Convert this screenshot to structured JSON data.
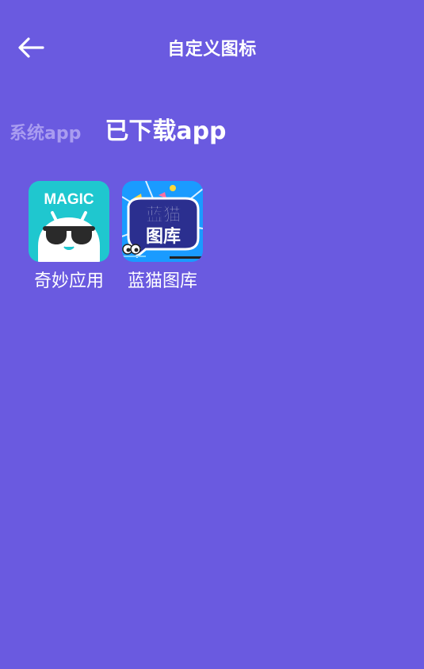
{
  "header": {
    "title": "自定义图标",
    "back_icon": "arrow-left-icon"
  },
  "tabs": [
    {
      "label": "系统app",
      "active": false
    },
    {
      "label": "已下载app",
      "active": true
    }
  ],
  "apps": [
    {
      "name": "奇妙应用",
      "icon": "magic-app-icon",
      "icon_text": "MAGIC",
      "icon_bg": "#1fc7cf"
    },
    {
      "name": "蓝猫图库",
      "icon": "bluecat-gallery-icon",
      "icon_text": "蓝猫图库",
      "icon_bg": "#1a9bff"
    }
  ],
  "colors": {
    "background": "#6a5ae0",
    "inactive_tab": "#a99cf0",
    "text": "#ffffff"
  }
}
